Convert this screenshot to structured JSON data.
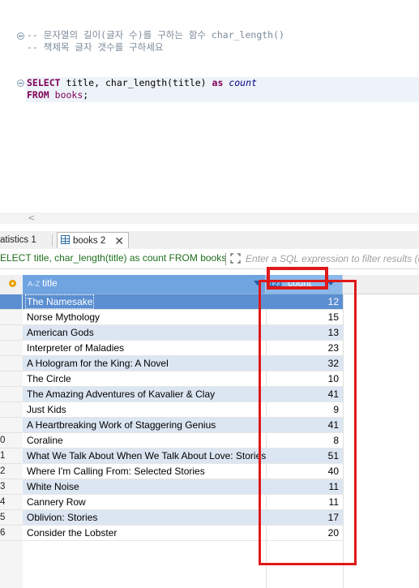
{
  "editor": {
    "comment1": "-- 문자열의 길이(글자 수)를 구하는 함수 char_length()",
    "comment2": "-- 책제목 글자 갯수를 구하세요",
    "sql": {
      "select_kw": "SELECT",
      "col": "title,",
      "fn": "char_length(title)",
      "as_kw": "as",
      "alias": "count",
      "from_kw": "FROM",
      "table": "books",
      "semicolon": ";"
    },
    "scroll_arrow": "<"
  },
  "tabs": {
    "statistics_label": "atistics 1",
    "books_label": "books 2",
    "close_glyph": "✕"
  },
  "filter": {
    "query_text": "ELECT title, char_length(title) as count FROM books",
    "placeholder": "Enter a SQL expression to filter results (u"
  },
  "grid": {
    "columns": [
      {
        "type_icon": "A-Z",
        "name": "title"
      },
      {
        "type_icon": "123",
        "name": "count"
      }
    ],
    "row_numbers": [
      "",
      "",
      "",
      "",
      "",
      "",
      "",
      "",
      "",
      "0",
      "1",
      "2",
      "3",
      "4",
      "5",
      "6"
    ],
    "rows": [
      {
        "title": "The Namesake",
        "count": "12"
      },
      {
        "title": "Norse Mythology",
        "count": "15"
      },
      {
        "title": "American Gods",
        "count": "13"
      },
      {
        "title": "Interpreter of Maladies",
        "count": "23"
      },
      {
        "title": "A Hologram for the King: A Novel",
        "count": "32"
      },
      {
        "title": "The Circle",
        "count": "10"
      },
      {
        "title": "The Amazing Adventures of Kavalier & Clay",
        "count": "41"
      },
      {
        "title": "Just Kids",
        "count": "9"
      },
      {
        "title": "A Heartbreaking Work of Staggering Genius",
        "count": "41"
      },
      {
        "title": "Coraline",
        "count": "8"
      },
      {
        "title": "What We Talk About When We Talk About Love: Stories",
        "count": "51"
      },
      {
        "title": "Where I'm Calling From: Selected Stories",
        "count": "40"
      },
      {
        "title": "White Noise",
        "count": "11"
      },
      {
        "title": "Cannery Row",
        "count": "11"
      },
      {
        "title": "Oblivion: Stories",
        "count": "17"
      },
      {
        "title": "Consider the Lobster",
        "count": "20"
      }
    ],
    "selected_row": 0
  },
  "colors": {
    "annotation": "#e01818",
    "header_title": "#6fa4e1",
    "header_count": "#8bb8ea",
    "row_alt": "#dce6f2",
    "row_selected": "#5b8fd1"
  }
}
